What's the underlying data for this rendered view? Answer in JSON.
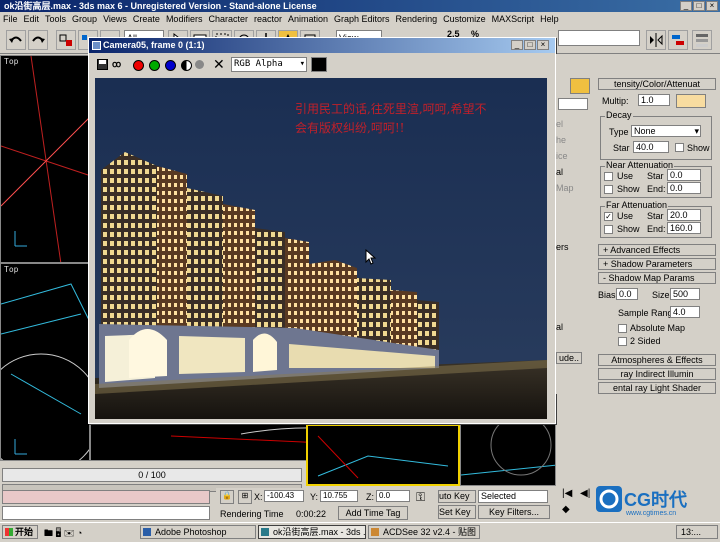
{
  "app": {
    "title": "ok沿街高层.max - 3ds max 6 - Unregistered Version - Stand-alone License",
    "menu": [
      "File",
      "Edit",
      "Tools",
      "Group",
      "Views",
      "Create",
      "Modifiers",
      "Character",
      "reactor",
      "Animation",
      "Graph Editors",
      "Rendering",
      "Customize",
      "MAXScript",
      "Help"
    ],
    "toolbar_dropdowns": {
      "filter": "All",
      "view": "View"
    },
    "toolbar_numbers": [
      "2.5",
      "%"
    ]
  },
  "viewports": {
    "top_left": "Top",
    "bottom_left": "Top"
  },
  "render_window": {
    "title": "Camera05, frame 0 (1:1)",
    "channel": "RGB Alpha",
    "overlay_text": "引用民工的话,往死里渲,呵呵,希望不会有版权纠纷,呵呵!!"
  },
  "command_panel": {
    "rollouts": {
      "intensity": "tensity/Color/Attenuat",
      "advanced": "+  Advanced Effects",
      "shadow_params": "+  Shadow Parameters",
      "shadow_map": "-  Shadow Map Params",
      "atmos": "Atmospheres & Effects",
      "mray_indirect": "ray Indirect Illumin",
      "mray_light": "ental ray Light Shader"
    },
    "multiplier_label": "Multip:",
    "multiplier": "1.0",
    "decay": {
      "label": "Decay",
      "type_label": "Type",
      "type": "None",
      "start_label": "Star",
      "start": "40.0",
      "show_label": "Show"
    },
    "near": {
      "label": "Near Attenuation",
      "use": "Use",
      "show": "Show",
      "start_label": "Star",
      "start": "0.0",
      "end_label": "End:",
      "end": "0.0"
    },
    "far": {
      "label": "Far Attenuation",
      "use": "Use",
      "show": "Show",
      "start_label": "Star",
      "start": "20.0",
      "end_label": "End:",
      "end": "160.0"
    },
    "shadow": {
      "bias_label": "Bias:",
      "bias": "0.0",
      "size_label": "Size:",
      "size": "500",
      "range_label": "Sample Range:",
      "range": "4.0",
      "absolute": "Absolute Map",
      "two_sided": "2 Sided"
    },
    "left_strip": [
      "el",
      "he",
      "ice",
      "al",
      "Map",
      "ers",
      "al",
      "ude.."
    ]
  },
  "status": {
    "timeline": "0 / 100",
    "x_label": "X:",
    "x": "-100.43",
    "y_label": "Y:",
    "y": "10.755",
    "z_label": "Z:",
    "z": "0.0",
    "render_time_label": "Rendering Time",
    "render_time": "0:00:22",
    "add_time_tag": "Add Time Tag",
    "auto_key": "uto Key",
    "selected": "Selected",
    "set_key": "Set Key",
    "key_filters": "Key Filters...",
    "watermark": "CG时代",
    "watermark_url": "www.cgtimes.cn"
  },
  "taskbar": {
    "start": "开始",
    "tasks": [
      "Adobe Photoshop",
      "ok沿街高层.max - 3ds ...",
      "ACDSee 32 v2.4 - 贴图"
    ],
    "clock": "13:..."
  }
}
